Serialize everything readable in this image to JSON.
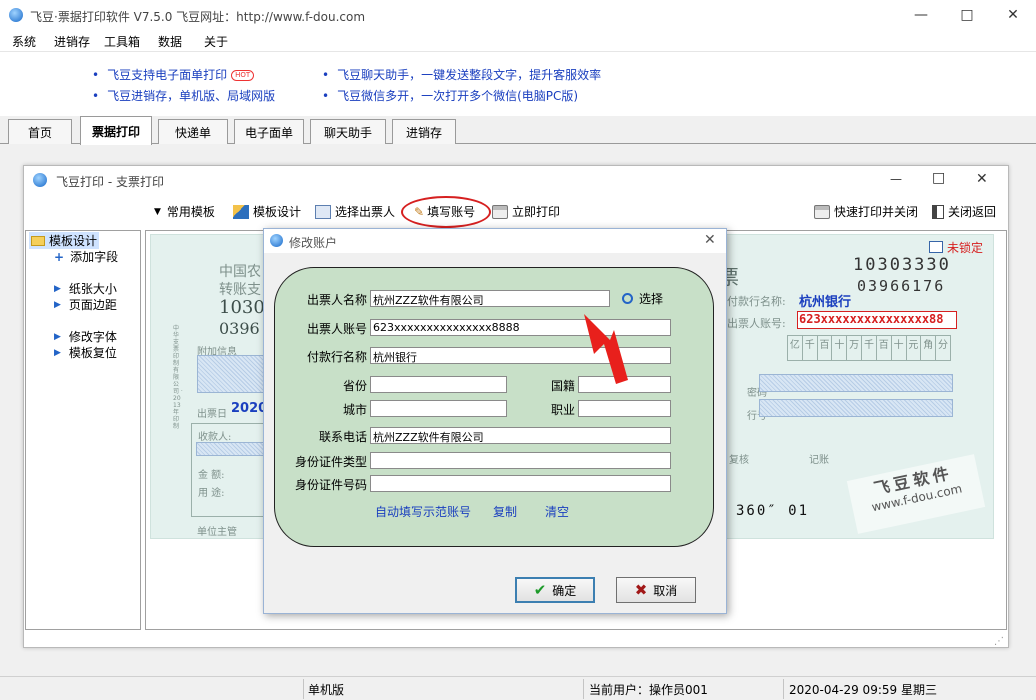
{
  "app": {
    "title": "飞豆·票据打印软件 V7.5.0   飞豆网址：http://www.f-dou.com"
  },
  "menu": [
    "系统",
    "进销存",
    "工具箱",
    "数据",
    "关于"
  ],
  "promo": {
    "left": [
      "飞豆支持电子面单打印",
      "飞豆进销存，单机版、局域网版"
    ],
    "hot": "HOT",
    "right": [
      "飞豆聊天助手，一键发送整段文字，提升客服效率",
      "飞豆微信多开，一次打开多个微信(电脑PC版)"
    ]
  },
  "tabs": [
    "首页",
    "票据打印",
    "快递单",
    "电子面单",
    "聊天助手",
    "进销存"
  ],
  "child": {
    "title": "飞豆打印 - 支票打印"
  },
  "toolbar": {
    "template": "常用模板",
    "design": "模板设计",
    "drawer": "选择出票人",
    "fill": "填写账号",
    "print": "立即打印",
    "quick": "快速打印并关闭",
    "close": "关闭返回"
  },
  "sidebar": {
    "folder": "模板设计",
    "items": [
      "添加字段",
      "纸张大小",
      "页面边距",
      "修改字体",
      "模板复位"
    ]
  },
  "cheque": {
    "bank1": "中国农",
    "transfer": "转账支",
    "num_l1": "1030",
    "num_l2": "0396",
    "attach": "附加信息",
    "date_label": "出票日",
    "date_val": "2020",
    "payee": "收款人:",
    "amount": "金  额:",
    "use": "用  途:",
    "unit": "单位主管",
    "side": "中华支票印制有限公司 · 2013年印制",
    "ticket": "票",
    "num_r1": "10303330",
    "num_r2": "03966176",
    "lock": "未锁定",
    "payer_bank_label": "付款行名称:",
    "payer_bank": "杭州银行",
    "drawer_acct_label": "出票人账号:",
    "drawer_acct": "623xxxxxxxxxxxxxxx88",
    "digits": [
      "亿",
      "千",
      "百",
      "十",
      "万",
      "千",
      "百",
      "十",
      "元",
      "角",
      "分"
    ],
    "pwd": "密码",
    "row": "行号",
    "review": "复核",
    "book": "记账",
    "micr": "360″ 01",
    "wm1": "飞豆软件",
    "wm2": "www.f-dou.com"
  },
  "dialog": {
    "title": "修改账户",
    "fields": {
      "drawer_name": "出票人名称",
      "drawer_acct": "出票人账号",
      "pay_bank": "付款行名称",
      "province": "省份",
      "nation": "国籍",
      "city": "城市",
      "job": "职业",
      "phone": "联系电话",
      "id_type": "身份证件类型",
      "id_no": "身份证件号码"
    },
    "values": {
      "drawer_name": "杭州ZZZ软件有限公司",
      "drawer_acct": "623xxxxxxxxxxxxxxx8888",
      "pay_bank": "杭州银行",
      "province": "",
      "nation": "",
      "city": "",
      "job": "",
      "phone": "杭州ZZZ软件有限公司",
      "id_type": "",
      "id_no": ""
    },
    "select": "选择",
    "autofill": "自动填写示范账号",
    "copy": "复制",
    "clear": "清空",
    "ok": "确定",
    "cancel": "取消"
  },
  "status": {
    "edition": "单机版",
    "user": "当前用户：操作员001",
    "datetime": "2020-04-29 09:59 星期三"
  },
  "colors": {
    "link": "#1a3fbf",
    "accent": "#d62020",
    "panel": "#c8e0c8"
  }
}
